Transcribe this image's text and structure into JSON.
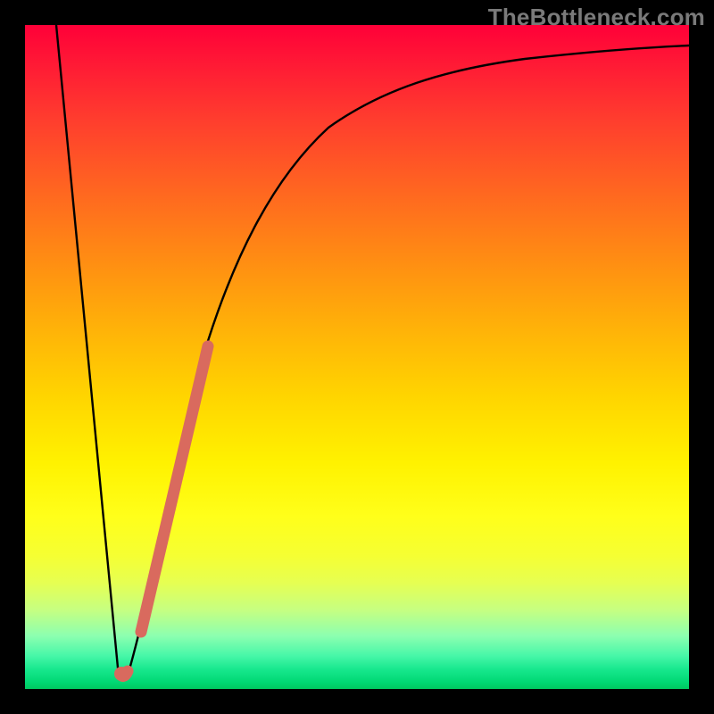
{
  "watermark": "TheBottleneck.com",
  "chart_data": {
    "type": "line",
    "title": "",
    "xlabel": "",
    "ylabel": "",
    "xlim": [
      0,
      100
    ],
    "ylim": [
      0,
      100
    ],
    "grid": false,
    "legend": false,
    "series": [
      {
        "name": "bottleneck-curve",
        "x": [
          0,
          5,
          10,
          12,
          14,
          15,
          20,
          25,
          30,
          35,
          40,
          50,
          60,
          70,
          80,
          90,
          100
        ],
        "y": [
          100,
          65,
          20,
          3,
          2,
          5,
          30,
          48,
          60,
          68,
          74,
          82,
          86,
          89,
          91,
          92.5,
          93.5
        ],
        "color": "#000000"
      },
      {
        "name": "highlight-segment",
        "x": [
          14,
          14.5,
          16,
          18.5,
          21,
          23.5,
          26,
          28
        ],
        "y": [
          2,
          2.5,
          8,
          21,
          33,
          43,
          50,
          55
        ],
        "color": "#d96a5e"
      }
    ],
    "annotations": []
  }
}
